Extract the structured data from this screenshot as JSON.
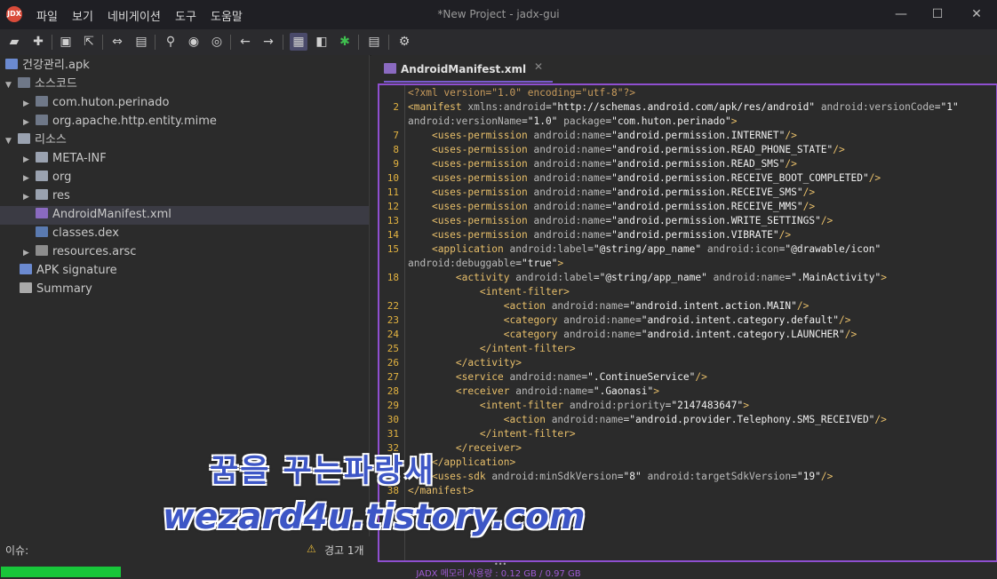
{
  "app": {
    "window_title": "*New Project - jadx-gui",
    "menu": [
      "파일",
      "보기",
      "네비게이션",
      "도구",
      "도움말"
    ],
    "logo_text": "JDX"
  },
  "window_controls": {
    "minimize": "—",
    "maximize": "☐",
    "close": "✕"
  },
  "toolbar": {
    "icons": [
      "open-folder-icon",
      "add-files-icon",
      "save-icon",
      "export-icon",
      "sync-icon",
      "project-icon",
      "search-icon",
      "find-class-icon",
      "find-usage-icon",
      "back-icon",
      "forward-icon",
      "deobfuscation-icon",
      "decompile-all-icon",
      "debugger-icon",
      "log-icon",
      "preferences-icon"
    ]
  },
  "tree": {
    "root": "건강관리.apk",
    "sources_label": "소스코드",
    "packages": [
      "com.huton.perinado",
      "org.apache.http.entity.mime"
    ],
    "resources_label": "리소스",
    "resource_folders": [
      "META-INF",
      "org",
      "res"
    ],
    "files": [
      "AndroidManifest.xml",
      "classes.dex",
      "resources.arsc"
    ],
    "apk_signature": "APK signature",
    "summary": "Summary"
  },
  "editor": {
    "tab_title": "AndroidManifest.xml",
    "line_numbers": [
      "",
      "2",
      "",
      "7",
      "8",
      "9",
      "10",
      "11",
      "12",
      "13",
      "14",
      "15",
      "",
      "18",
      "",
      "22",
      "23",
      "24",
      "25",
      "26",
      "27",
      "28",
      "29",
      "30",
      "31",
      "32",
      "",
      "",
      "38"
    ],
    "lines": [
      "<?xml version=\"1.0\" encoding=\"utf-8\"?>",
      "<manifest xmlns:android=\"http://schemas.android.com/apk/res/android\" android:versionCode=\"1\"",
      "android:versionName=\"1.0\" package=\"com.huton.perinado\">",
      "    <uses-permission android:name=\"android.permission.INTERNET\"/>",
      "    <uses-permission android:name=\"android.permission.READ_PHONE_STATE\"/>",
      "    <uses-permission android:name=\"android.permission.READ_SMS\"/>",
      "    <uses-permission android:name=\"android.permission.RECEIVE_BOOT_COMPLETED\"/>",
      "    <uses-permission android:name=\"android.permission.RECEIVE_SMS\"/>",
      "    <uses-permission android:name=\"android.permission.RECEIVE_MMS\"/>",
      "    <uses-permission android:name=\"android.permission.WRITE_SETTINGS\"/>",
      "    <uses-permission android:name=\"android.permission.VIBRATE\"/>",
      "    <application android:label=\"@string/app_name\" android:icon=\"@drawable/icon\"",
      "android:debuggable=\"true\">",
      "        <activity android:label=\"@string/app_name\" android:name=\".MainActivity\">",
      "            <intent-filter>",
      "                <action android:name=\"android.intent.action.MAIN\"/>",
      "                <category android:name=\"android.intent.category.default\"/>",
      "                <category android:name=\"android.intent.category.LAUNCHER\"/>",
      "            </intent-filter>",
      "        </activity>",
      "        <service android:name=\".ContinueService\"/>",
      "        <receiver android:name=\".Gaonasi\">",
      "            <intent-filter android:priority=\"2147483647\">",
      "                <action android:name=\"android.provider.Telephony.SMS_RECEIVED\"/>",
      "            </intent-filter>",
      "        </receiver>",
      "    </application>",
      "    <uses-sdk android:minSdkVersion=\"8\" android:targetSdkVersion=\"19\"/>",
      "</manifest>"
    ]
  },
  "watermark": {
    "line1": "꿈을 꾸는파랑새",
    "line2": "wezard4u.tistory.com"
  },
  "issues": {
    "label": "이슈:",
    "warning": "경고 1개"
  },
  "status": {
    "memory": "JADX 메모리 사용량 : 0.12 GB / 0.97 GB",
    "memory_fraction": 0.12
  },
  "colors": {
    "accent": "#8f4fd0",
    "memory_bar": "#18c63a",
    "line_number": "#e3b341"
  }
}
